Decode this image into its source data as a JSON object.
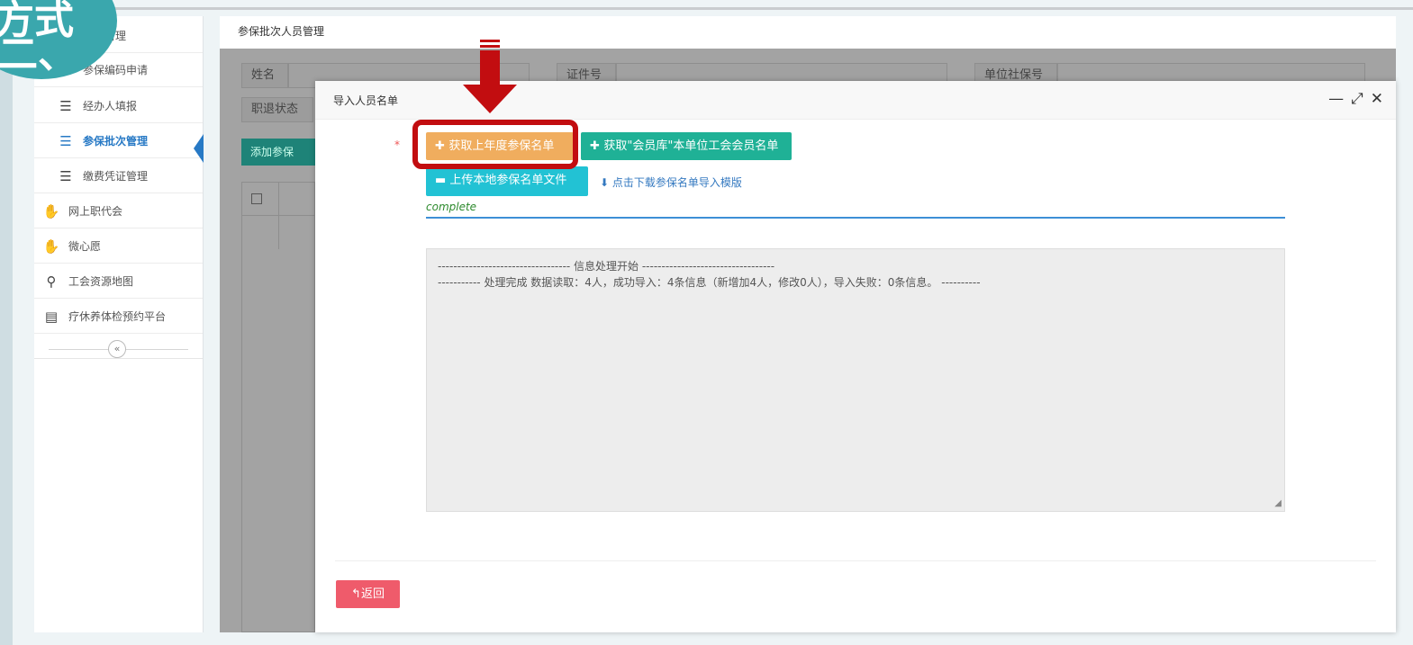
{
  "badge": {
    "line1": "方式",
    "line2": "二、"
  },
  "sidebar": {
    "items": [
      {
        "label": "保障管理",
        "icon": "list-icon"
      },
      {
        "label": "参保编码申请",
        "icon": "list-icon"
      },
      {
        "label": "经办人填报",
        "icon": "list-icon"
      },
      {
        "label": "参保批次管理",
        "icon": "list-icon",
        "active": true
      },
      {
        "label": "缴费凭证管理",
        "icon": "list-icon"
      },
      {
        "label": "网上职代会",
        "icon": "handshake-icon"
      },
      {
        "label": "微心愿",
        "icon": "handshake-icon"
      },
      {
        "label": "工会资源地图",
        "icon": "map-pin-icon"
      },
      {
        "label": "疗休养体检预约平台",
        "icon": "document-hand-icon"
      }
    ],
    "collapse_symbol": "«"
  },
  "main": {
    "title": "参保批次人员管理",
    "filters": {
      "name_label": "姓名",
      "id_label": "证件号",
      "unit_ss_label": "单位社保号",
      "retire_status_label": "职退状态"
    },
    "add_button": "添加参保"
  },
  "modal": {
    "title": "导入人员名单",
    "controls": {
      "minimize": "—",
      "maximize": "⤢",
      "close": "✕"
    },
    "required_mark": "*",
    "btn_last_year": "获取上年度参保名单",
    "btn_member_lib": "获取\"会员库\"本单位工会会员名单",
    "btn_upload": "上传本地参保名单文件",
    "download_link": "点击下载参保名单导入模版",
    "status": "complete",
    "log_lines": [
      "---------------------------------- 信息处理开始 ----------------------------------",
      "----------- 处理完成 数据读取：4人，成功导入：4条信息（新增加4人，修改0人），导入失败：0条信息。 ----------"
    ],
    "back_button": "返回"
  },
  "colors": {
    "accent": "#2779c5",
    "orange": "#f0ad5e",
    "green": "#1fb196",
    "cyan": "#22c2d4",
    "red_button": "#ef5b6b",
    "highlight": "#c20d10"
  }
}
